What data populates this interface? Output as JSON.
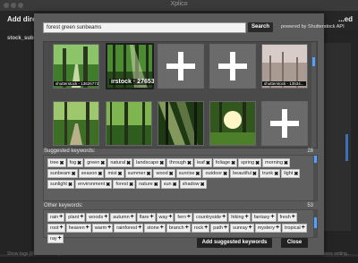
{
  "window": {
    "title": "Xplico"
  },
  "background": {
    "add_label": "Add direct...",
    "right_label": "...ed",
    "stock_label": "stock_subo...",
    "footer_left": "Show tags (Pikabot settings)",
    "footer_right": "...Preview setting...",
    "colors": {
      "app_bg": "#2d2d2d",
      "accent": "#3b6fb6"
    }
  },
  "search": {
    "query": "forest green sunbeams",
    "button_label": "Search",
    "powered_by": "powered by Shutterstock API"
  },
  "results": {
    "row1": [
      {
        "type": "image",
        "caption": "shutterstock - 13626773...",
        "selected": false
      },
      {
        "type": "image",
        "caption": "irstock · 276535",
        "selected": true
      },
      {
        "type": "placeholder"
      },
      {
        "type": "placeholder"
      },
      {
        "type": "image",
        "caption": "shutterstock - 13534...",
        "selected": false
      }
    ],
    "row2": [
      {
        "type": "image",
        "caption": "",
        "selected": false
      },
      {
        "type": "image",
        "caption": "",
        "selected": false
      },
      {
        "type": "image",
        "caption": "",
        "selected": false
      },
      {
        "type": "image",
        "caption": "",
        "selected": false
      },
      {
        "type": "placeholder"
      }
    ]
  },
  "suggested": {
    "label": "Suggested keywords:",
    "count": "28",
    "keywords": [
      "tree",
      "fog",
      "green",
      "natural",
      "landscape",
      "through",
      "leaf",
      "foliage",
      "spring",
      "morning",
      "sunbeam",
      "season",
      "mist",
      "summer",
      "wood",
      "sunrise",
      "outdoor",
      "beautiful",
      "trunk",
      "light",
      "sunlight",
      "environment",
      "forest",
      "nature",
      "sun",
      "shadow"
    ]
  },
  "other": {
    "label": "Other keywords:",
    "count": "53",
    "keywords": [
      "rain",
      "plant",
      "woods",
      "autumn",
      "flare",
      "way",
      "fern",
      "countryside",
      "hiking",
      "fantasy",
      "fresh",
      "root",
      "heaven",
      "warm",
      "rainforest",
      "stone",
      "branch",
      "rock",
      "path",
      "sunray",
      "mystery",
      "tropical",
      "ray"
    ]
  },
  "actions": {
    "add_suggested": "Add suggested keywords",
    "close": "Close"
  }
}
